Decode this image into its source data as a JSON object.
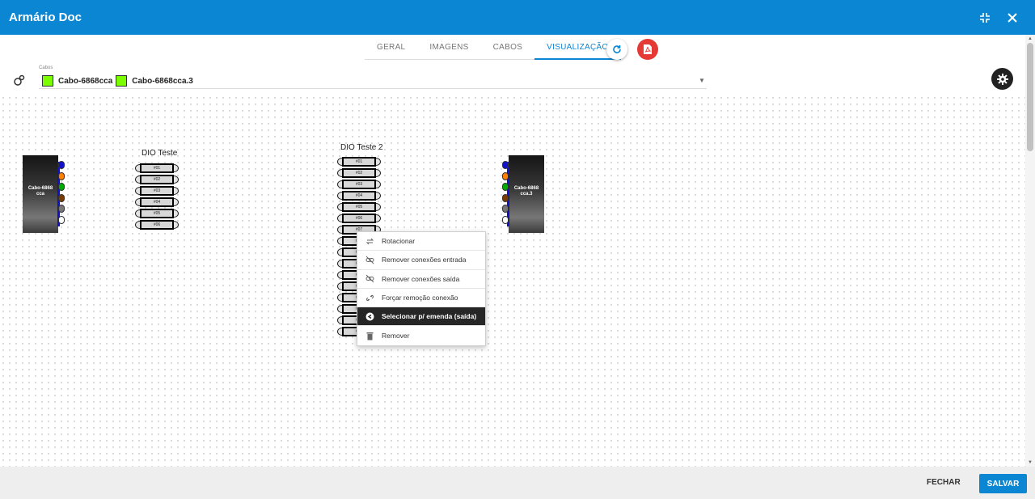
{
  "app": {
    "title": "Armário Doc"
  },
  "tabs": [
    {
      "label": "GERAL"
    },
    {
      "label": "IMAGENS"
    },
    {
      "label": "CABOS"
    },
    {
      "label": "VISUALIZAÇÃO",
      "active": true
    }
  ],
  "cabos": {
    "label": "Cabos",
    "selected": [
      {
        "name": "Cabo-6868cca",
        "color": "#7cfc00"
      },
      {
        "name": "Cabo-6868cca.3",
        "color": "#7cfc00"
      }
    ]
  },
  "diagram": {
    "cable_left": {
      "label": "Cabo-6868\ncca",
      "fiber_colors": [
        "#1111cc",
        "#ff7f00",
        "#00aa00",
        "#7a3b00",
        "#777777",
        "#ffffff"
      ]
    },
    "cable_right": {
      "label": "Cabo-6868\ncca.3",
      "fiber_colors": [
        "#1111cc",
        "#ff7f00",
        "#00aa00",
        "#7a3b00",
        "#777777",
        "#ffffff"
      ]
    },
    "dio1": {
      "title": "DIO Teste",
      "ports": [
        "#01",
        "#02",
        "#03",
        "#04",
        "#05",
        "#06"
      ]
    },
    "dio2": {
      "title": "DIO Teste 2",
      "ports": [
        "#01",
        "#02",
        "#03",
        "#04",
        "#05",
        "#06",
        "#07",
        "#08",
        "#09",
        "#10",
        "#11",
        "#12",
        "#13",
        "#14",
        "#15",
        "#16"
      ]
    }
  },
  "context_menu": {
    "items": [
      {
        "label": "Rotacionar",
        "icon": "rotate-icon"
      },
      {
        "label": "Remover conexões entrada",
        "icon": "unlink-icon"
      },
      {
        "label": "Remover conexões saída",
        "icon": "unlink-icon"
      },
      {
        "label": "Forçar remoção conexão",
        "icon": "broken-link-icon"
      },
      {
        "label": "Selecionar p/ emenda (saída)",
        "icon": "arrow-circle-icon",
        "selected": true
      },
      {
        "label": "Remover",
        "icon": "trash-icon"
      }
    ]
  },
  "footer": {
    "cancel_label": "FECHAR",
    "save_label": "SALVAR"
  }
}
